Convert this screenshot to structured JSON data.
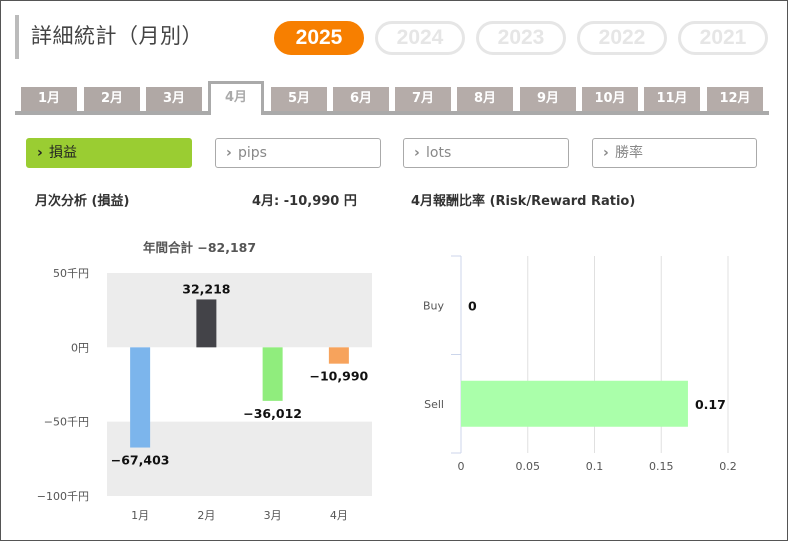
{
  "header": {
    "title": "詳細統計（月別）"
  },
  "years": [
    "2025",
    "2024",
    "2023",
    "2022",
    "2021"
  ],
  "selected_year": "2025",
  "months": [
    "1月",
    "2月",
    "3月",
    "4月",
    "5月",
    "6月",
    "7月",
    "8月",
    "9月",
    "10月",
    "11月",
    "12月"
  ],
  "selected_month": "4月",
  "filters": [
    {
      "label": "損益",
      "active": true
    },
    {
      "label": "pips",
      "active": false
    },
    {
      "label": "lots",
      "active": false
    },
    {
      "label": "勝率",
      "active": false
    }
  ],
  "left_panel": {
    "title": "月次分析 (損益)",
    "month_value": "4月:  -10,990 円",
    "annual_total": "年間合計 −82,187"
  },
  "right_panel": {
    "title": "4月報酬比率 (Risk/Reward Ratio)"
  },
  "chart_data": [
    {
      "type": "bar",
      "categories": [
        "1月",
        "2月",
        "3月",
        "4月"
      ],
      "values": [
        -67403,
        32218,
        -36012,
        -10990
      ],
      "value_labels": [
        "−67,403",
        "32,218",
        "−36,012",
        "−10,990"
      ],
      "colors": [
        "#7cb5ec",
        "#434348",
        "#90ed7d",
        "#f7a35c"
      ],
      "ylim": [
        -100000,
        50000
      ],
      "yticks": [
        50000,
        0,
        -50000,
        -100000
      ],
      "ytick_labels": [
        "50千円",
        "0円",
        "−50千円",
        "−100千円"
      ]
    },
    {
      "type": "bar",
      "orientation": "horizontal",
      "categories": [
        "Buy",
        "Sell"
      ],
      "values": [
        0,
        0.17
      ],
      "value_labels": [
        "0",
        "0.17"
      ],
      "color": "#aaffaa",
      "xlim": [
        0,
        0.2
      ],
      "xticks": [
        0,
        0.05,
        0.1,
        0.15,
        0.2
      ],
      "xtick_labels": [
        "0",
        "0.05",
        "0.1",
        "0.15",
        "0.2"
      ]
    }
  ]
}
